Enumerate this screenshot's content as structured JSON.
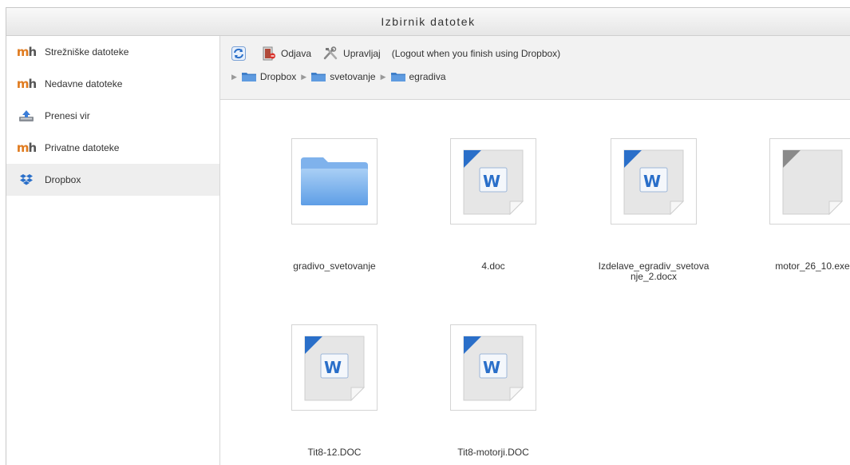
{
  "title": "Izbirnik datotek",
  "sidebar": {
    "items": [
      {
        "label": "Strežniške datoteke",
        "icon": "moodle-icon",
        "active": false
      },
      {
        "label": "Nedavne datoteke",
        "icon": "moodle-icon",
        "active": false
      },
      {
        "label": "Prenesi vir",
        "icon": "upload-icon",
        "active": false
      },
      {
        "label": "Privatne datoteke",
        "icon": "moodle-icon",
        "active": false
      },
      {
        "label": "Dropbox",
        "icon": "dropbox-icon",
        "active": true
      }
    ]
  },
  "toolbar": {
    "refresh_icon": "refresh-icon",
    "logout_label": "Odjava",
    "manage_label": "Upravljaj",
    "note": "(Logout when you finish using Dropbox)"
  },
  "path": [
    "Dropbox",
    "svetovanje",
    "egradiva"
  ],
  "files": [
    {
      "name": "gradivo_svetovanje",
      "type": "folder"
    },
    {
      "name": "4.doc",
      "type": "word"
    },
    {
      "name": "Izdelave_egradiv_svetovanje_2.docx",
      "type": "word"
    },
    {
      "name": "motor_26_10.exe",
      "type": "generic"
    },
    {
      "name": "Tit8-12.DOC",
      "type": "word"
    },
    {
      "name": "Tit8-motorji.DOC",
      "type": "word"
    }
  ],
  "colors": {
    "accent": "#2a6fc9",
    "active_bg": "#eeeeee",
    "toolbar_bg": "#f2f2f2"
  }
}
